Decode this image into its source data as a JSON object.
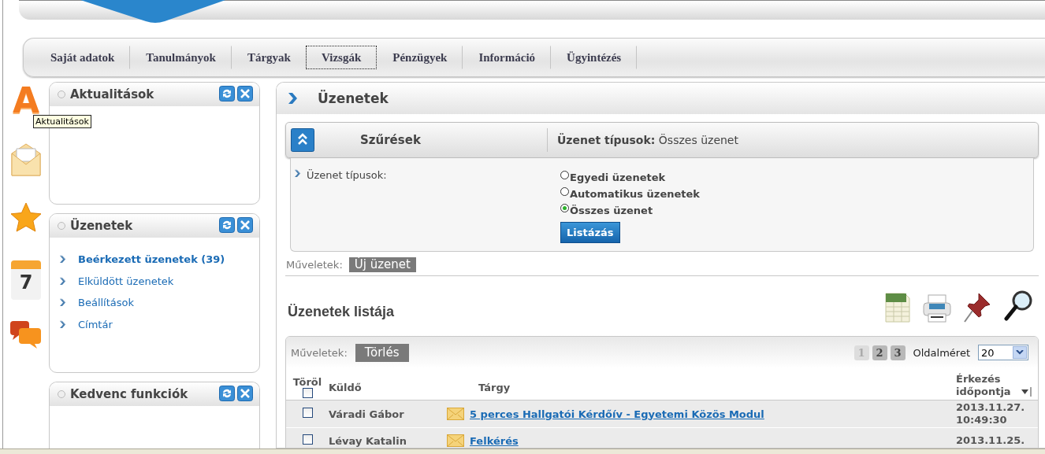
{
  "nav": {
    "tabs": [
      {
        "label": "Saját adatok",
        "selected": false
      },
      {
        "label": "Tanulmányok",
        "selected": false
      },
      {
        "label": "Tárgyak",
        "selected": false
      },
      {
        "label": "Vizsgák",
        "selected": true
      },
      {
        "label": "Pénzügyek",
        "selected": false
      },
      {
        "label": "Információ",
        "selected": false
      },
      {
        "label": "Ügyintézés",
        "selected": false
      }
    ]
  },
  "side_bar": {
    "letter_icon": "A",
    "calendar_day": "7",
    "tooltip": "Aktualitások"
  },
  "widgets": [
    {
      "title": "Aktualitások"
    },
    {
      "title": "Üzenetek",
      "items": [
        {
          "label": "Beérkezett üzenetek (39)",
          "selected": true
        },
        {
          "label": "Elküldött üzenetek",
          "selected": false
        },
        {
          "label": "Beállítások",
          "selected": false
        },
        {
          "label": "Címtár",
          "selected": false
        }
      ]
    },
    {
      "title": "Kedvenc funkciók"
    }
  ],
  "main": {
    "title": "Üzenetek",
    "filter": {
      "title": "Szűrések",
      "summary_label": "Üzenet típusok:",
      "summary_value": "Összes üzenet",
      "field_label": "Üzenet típusok:",
      "options": [
        {
          "label": "Egyedi üzenetek",
          "selected": false
        },
        {
          "label": "Automatikus üzenetek",
          "selected": false
        },
        {
          "label": "Összes üzenet",
          "selected": true
        }
      ],
      "button": "Listázás"
    },
    "actions": {
      "label": "Műveletek:",
      "button": "Új üzenet"
    },
    "list": {
      "title": "Üzenetek listája",
      "actions_label": "Műveletek:",
      "delete_button": "Törlés",
      "pages": [
        {
          "label": "1",
          "selected": true
        },
        {
          "label": "2",
          "selected": false
        },
        {
          "label": "3",
          "selected": false
        }
      ],
      "page_size_label": "Oldalméret",
      "page_size": "20",
      "columns": [
        "Töröl",
        "Küldő",
        "Tárgy",
        "Érkezés időpontja"
      ],
      "select_all_checked": false,
      "rows": [
        {
          "checked": false,
          "sender": "Váradi Gábor",
          "subject": "5 perces Hallgatói Kérdőív - Egyetemi Közös Modul",
          "arrival": "2013.11.27. 10:49:30"
        },
        {
          "checked": false,
          "sender": "Lévay Katalin",
          "subject": "Felkérés",
          "arrival": "2013.11.25."
        }
      ]
    }
  }
}
